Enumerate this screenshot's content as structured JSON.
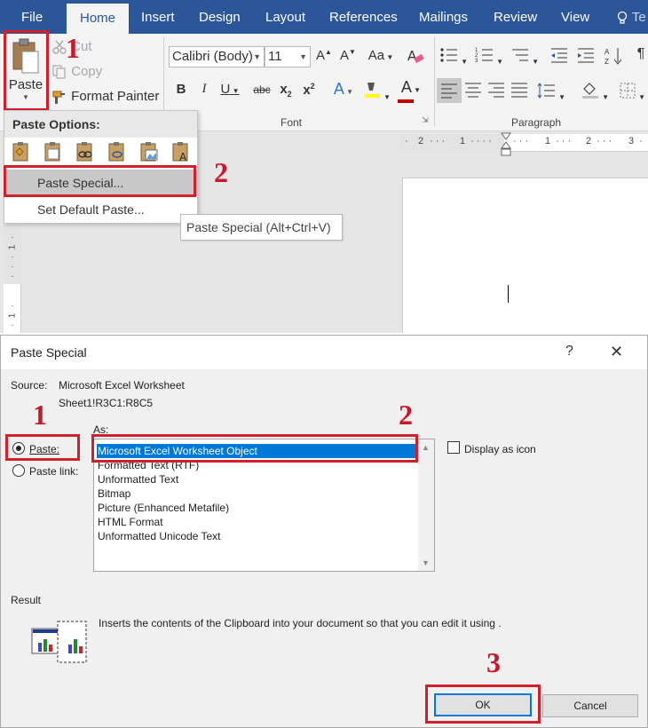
{
  "ribbon": {
    "tabs": [
      {
        "label": "File"
      },
      {
        "label": "Home"
      },
      {
        "label": "Insert"
      },
      {
        "label": "Design"
      },
      {
        "label": "Layout"
      },
      {
        "label": "References"
      },
      {
        "label": "Mailings"
      },
      {
        "label": "Review"
      },
      {
        "label": "View"
      },
      {
        "label": "Te"
      }
    ],
    "clipboard": {
      "paste_label": "Paste",
      "cut_label": "Cut",
      "copy_label": "Copy",
      "format_painter_label": "Format Painter"
    },
    "font": {
      "font_name": "Calibri (Body)",
      "font_size": "11",
      "group_label": "Font"
    },
    "paragraph": {
      "group_label": "Paragraph"
    }
  },
  "paste_menu": {
    "header": "Paste Options:",
    "items": [
      {
        "label": "Paste Special..."
      },
      {
        "label": "Set Default Paste..."
      }
    ],
    "tooltip": "Paste Special (Alt+Ctrl+V)"
  },
  "ruler": {
    "marks": [
      "2",
      "1",
      "1",
      "2",
      "3"
    ]
  },
  "annotations": {
    "top": [
      "1",
      "2"
    ],
    "dialog": [
      "1",
      "2",
      "3"
    ]
  },
  "dialog": {
    "title": "Paste Special",
    "help": "?",
    "close": "✕",
    "source_label": "Source:",
    "source_value": "Microsoft Excel Worksheet",
    "source_range": "Sheet1!R3C1:R8C5",
    "as_label": "As:",
    "paste_option": "Paste:",
    "paste_link_option": "Paste link:",
    "formats": [
      {
        "label": "Microsoft Excel Worksheet Object"
      },
      {
        "label": "Formatted Text (RTF)"
      },
      {
        "label": "Unformatted Text"
      },
      {
        "label": "Bitmap"
      },
      {
        "label": "Picture (Enhanced Metafile)"
      },
      {
        "label": "HTML Format"
      },
      {
        "label": "Unformatted Unicode Text"
      }
    ],
    "display_as_icon": "Display as icon",
    "result_label": "Result",
    "result_text": "Inserts the contents of the Clipboard into your document so that you can edit it using .",
    "ok_label": "OK",
    "cancel_label": "Cancel"
  }
}
